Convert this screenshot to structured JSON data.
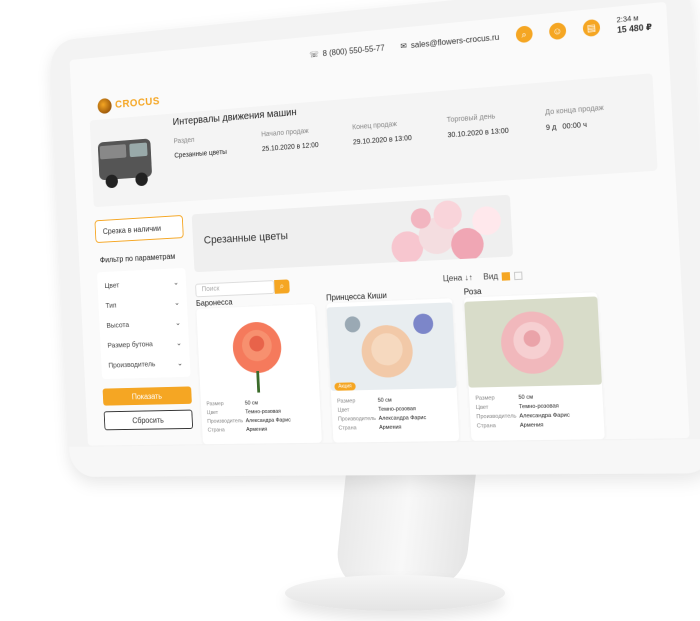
{
  "header": {
    "phone": "8 (800) 550-55-77",
    "email": "sales@flowers-crocus.ru",
    "cart_time": "2:34 м",
    "cart_total": "15 480 ₽"
  },
  "logo": {
    "name": "CROCUS",
    "subtitle": ""
  },
  "interval": {
    "title": "Интервалы движения машин",
    "columns": [
      "Раздел",
      "Начало продаж",
      "Конец продаж",
      "Торговый день",
      "До конца продаж"
    ],
    "row": [
      "Срезанные цветы",
      "25.10.2020 в 12:00",
      "29.10.2020 в 13:00",
      "30.10.2020 в 13:00",
      "9 д",
      "00:00 ч"
    ]
  },
  "sidebar": {
    "in_stock": "Срезка в наличии",
    "filter_title": "Фильтр по параметрам",
    "filters": [
      "Цвет",
      "Тип",
      "Высота",
      "Размер бутона",
      "Производитель"
    ],
    "show_button": "Показать",
    "reset_button": "Сбросить"
  },
  "banner": {
    "title": "Срезанные цветы"
  },
  "toolbar": {
    "search_placeholder": "Поиск",
    "sort_label": "Цена",
    "view_label": "Вид"
  },
  "spec_labels": [
    "Размер",
    "Цвет",
    "Производитель",
    "Страна"
  ],
  "products": [
    {
      "name": "Баронесса",
      "badge": "",
      "specs": [
        "50 см",
        "Темно-розовая",
        "Александра Фарис",
        "Армения"
      ],
      "color": "#f57a5c"
    },
    {
      "name": "Принцесса Киши",
      "badge": "Акция",
      "specs": [
        "50 см",
        "Темно-розовая",
        "Александра Фарис",
        "Армения"
      ],
      "color": "#f2c9a8"
    },
    {
      "name": "Роза",
      "badge": "",
      "specs": [
        "50 см",
        "Темно-розовая",
        "Александра Фарис",
        "Армения"
      ],
      "color": "#f1b8bc"
    }
  ],
  "colors": {
    "accent": "#f5a623"
  }
}
